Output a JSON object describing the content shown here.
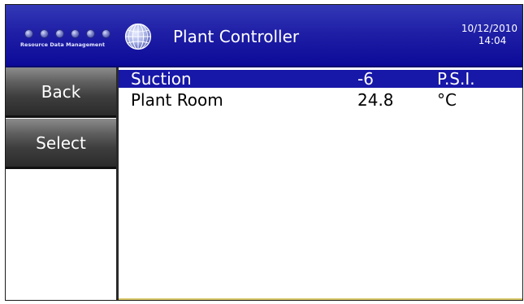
{
  "header": {
    "logo_text": "Resource Data Management",
    "title": "Plant Controller",
    "date": "10/12/2010",
    "time": "14:04",
    "logo_icon": "rdm-dots-logo",
    "globe_icon": "globe-icon",
    "colors": {
      "background": "#1f1fa6",
      "text": "#ffffff"
    }
  },
  "sidebar": {
    "buttons": [
      {
        "label": "Back"
      },
      {
        "label": "Select"
      }
    ]
  },
  "list": {
    "rows": [
      {
        "name": "Suction",
        "value": "-6",
        "unit": "P.S.I.",
        "selected": true
      },
      {
        "name": "Plant Room",
        "value": "24.8",
        "unit": "°C",
        "selected": false
      }
    ],
    "colors": {
      "selected_background": "#1717a8",
      "selected_text": "#ffffff"
    }
  }
}
